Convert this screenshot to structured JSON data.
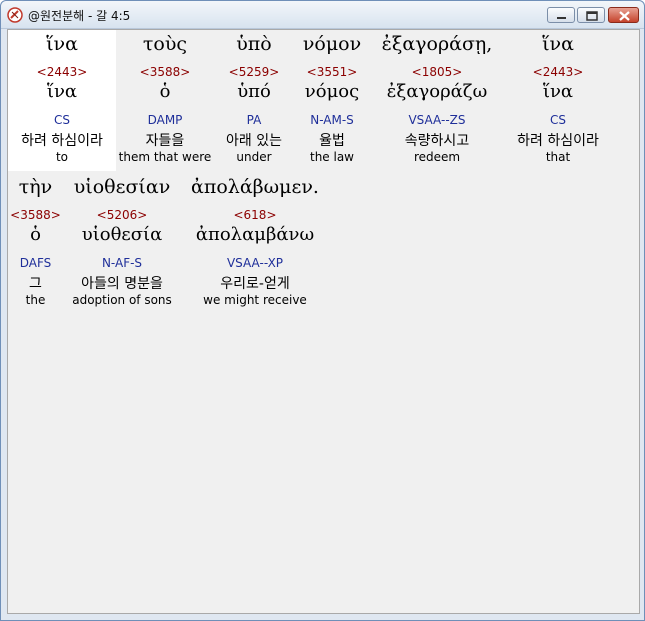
{
  "window": {
    "title": "@원전분해 - 갈 4:5"
  },
  "lines": [
    {
      "words": [
        {
          "greek": "ἵνα",
          "strong": "<2443>",
          "lemma": "ἵνα",
          "parse": "CS",
          "korean": "하려 하심이라",
          "english": "to",
          "highlighted": true
        },
        {
          "greek": "τοὺς",
          "strong": "<3588>",
          "lemma": "ὁ",
          "parse": "DAMP",
          "korean": "자들을",
          "english": "them that were",
          "highlighted": false
        },
        {
          "greek": "ὑπὸ",
          "strong": "<5259>",
          "lemma": "ὑπό",
          "parse": "PA",
          "korean": "아래 있는",
          "english": "under",
          "highlighted": false
        },
        {
          "greek": "νόμον",
          "strong": "<3551>",
          "lemma": "νόμος",
          "parse": "N-AM-S",
          "korean": "율법",
          "english": "the law",
          "highlighted": false
        },
        {
          "greek": "ἐξαγοράσῃ,",
          "strong": "<1805>",
          "lemma": "ἐξαγοράζω",
          "parse": "VSAA--ZS",
          "korean": "속량하시고",
          "english": "redeem",
          "highlighted": false
        },
        {
          "greek": "ἵνα",
          "strong": "<2443>",
          "lemma": "ἵνα",
          "parse": "CS",
          "korean": "하려 하심이라",
          "english": "that",
          "highlighted": false
        }
      ]
    },
    {
      "words": [
        {
          "greek": "τὴν",
          "strong": "<3588>",
          "lemma": "ὁ",
          "parse": "DAFS",
          "korean": "그",
          "english": "the",
          "highlighted": false
        },
        {
          "greek": "υἱοθεσίαν",
          "strong": "<5206>",
          "lemma": "υἱοθεσία",
          "parse": "N-AF-S",
          "korean": "아들의 명분을",
          "english": "adoption of sons",
          "highlighted": false
        },
        {
          "greek": "ἀπολάβωμεν.",
          "strong": "<618>",
          "lemma": "ἀπολαμβάνω",
          "parse": "VSAA--XP",
          "korean": "우리로-얻게",
          "english": "we might receive",
          "highlighted": false
        }
      ]
    }
  ]
}
